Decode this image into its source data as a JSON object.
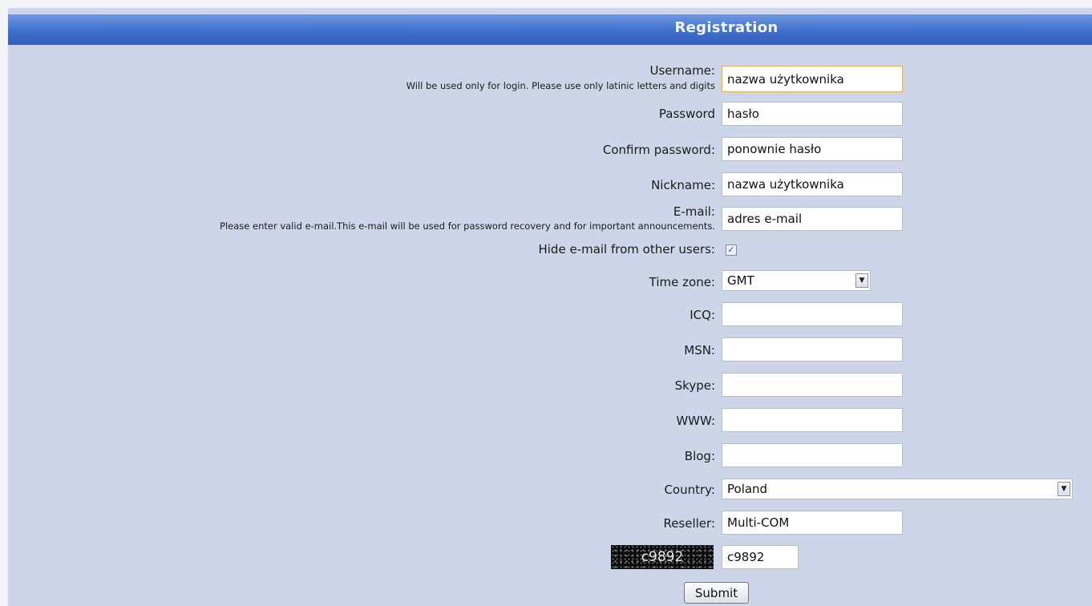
{
  "form": {
    "title": "Registration",
    "username": {
      "label": "Username:",
      "hint": "Will be used only for login. Please use only latinic letters and digits",
      "value": "nazwa użytkownika"
    },
    "password": {
      "label": "Password",
      "value": "hasło"
    },
    "confirm_password": {
      "label": "Confirm password:",
      "value": "ponownie hasło"
    },
    "nickname": {
      "label": "Nickname:",
      "value": "nazwa użytkownika"
    },
    "email": {
      "label": "E-mail:",
      "hint": "Please enter valid e-mail.This e-mail will be used for password recovery and for important announcements.",
      "value": "adres e-mail"
    },
    "hide_email": {
      "label": "Hide e-mail from other users:",
      "checked": true
    },
    "time_zone": {
      "label": "Time zone:",
      "value": "GMT"
    },
    "icq": {
      "label": "ICQ:",
      "value": ""
    },
    "msn": {
      "label": "MSN:",
      "value": ""
    },
    "skype": {
      "label": "Skype:",
      "value": ""
    },
    "www": {
      "label": "WWW:",
      "value": ""
    },
    "blog": {
      "label": "Blog:",
      "value": ""
    },
    "country": {
      "label": "Country:",
      "value": "Poland"
    },
    "reseller": {
      "label": "Reseller:",
      "value": "Multi-COM"
    },
    "captcha": {
      "image_text": "c9892",
      "value": "c9892"
    },
    "submit_label": "Submit"
  },
  "icons": {
    "dropdown": "chevron-down-icon",
    "check": "checkmark-icon"
  },
  "colors": {
    "header_bar": "#3f6fcc",
    "panel_background": "#cdd6e9"
  }
}
